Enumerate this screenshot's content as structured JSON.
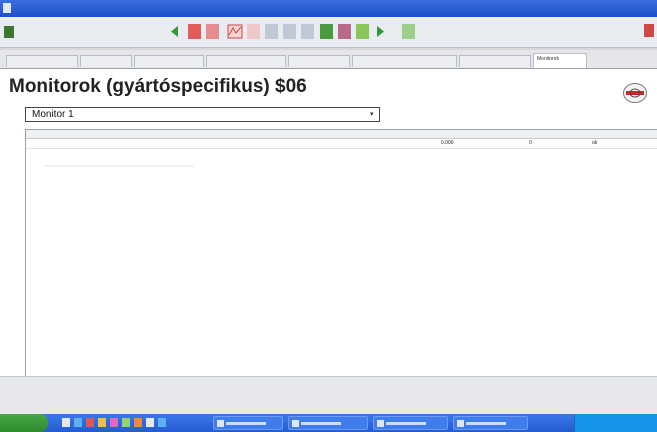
{
  "window": {
    "title": ""
  },
  "toolbar": {
    "vehicle_label": ""
  },
  "tabs": [
    {
      "label": "",
      "active": false
    },
    {
      "label": "",
      "active": false
    },
    {
      "label": "",
      "active": false
    },
    {
      "label": "",
      "active": false
    },
    {
      "label": "",
      "active": false
    },
    {
      "label": "",
      "active": false
    },
    {
      "label": "",
      "active": false
    },
    {
      "label": "Monitorok",
      "active": true
    }
  ],
  "page": {
    "title": "Monitorok (gyártóspecifikus) $06"
  },
  "monitor_select": {
    "value": "Monitor 1"
  },
  "table": {
    "headers": [
      "",
      "",
      "",
      "",
      "",
      ""
    ],
    "rows": [
      {
        "c1": "",
        "c2": "",
        "c3": "",
        "c4": "0.000",
        "c5": "0",
        "c6": "ok"
      }
    ]
  },
  "taskbar": {
    "start_label": ""
  },
  "colors": {
    "titlebar": "#1c4fc8",
    "taskbar": "#245bd1",
    "start": "#2d8a2d"
  }
}
